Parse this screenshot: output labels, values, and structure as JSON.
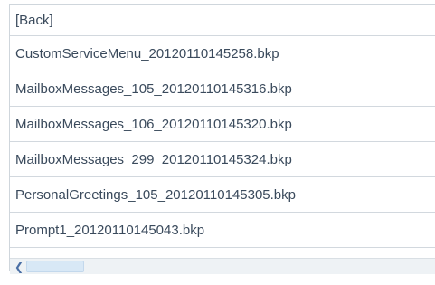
{
  "file_list": {
    "items": [
      {
        "label": "[Back]"
      },
      {
        "label": "CustomServiceMenu_20120110145258.bkp"
      },
      {
        "label": "MailboxMessages_105_20120110145316.bkp"
      },
      {
        "label": "MailboxMessages_106_20120110145320.bkp"
      },
      {
        "label": "MailboxMessages_299_20120110145324.bkp"
      },
      {
        "label": "PersonalGreetings_105_20120110145305.bkp"
      },
      {
        "label": "Prompt1_20120110145043.bkp"
      }
    ]
  },
  "scrollbar": {
    "left_arrow_glyph": "❮",
    "left_arrow_icon": "chevron-left-icon"
  },
  "colors": {
    "text": "#3a4a5c",
    "row_divider": "#d2d8de",
    "scrollbar_track": "#eef2f5",
    "scrollbar_thumb": "#d8e8f6",
    "scroll_arrow": "#4a6fa5"
  }
}
